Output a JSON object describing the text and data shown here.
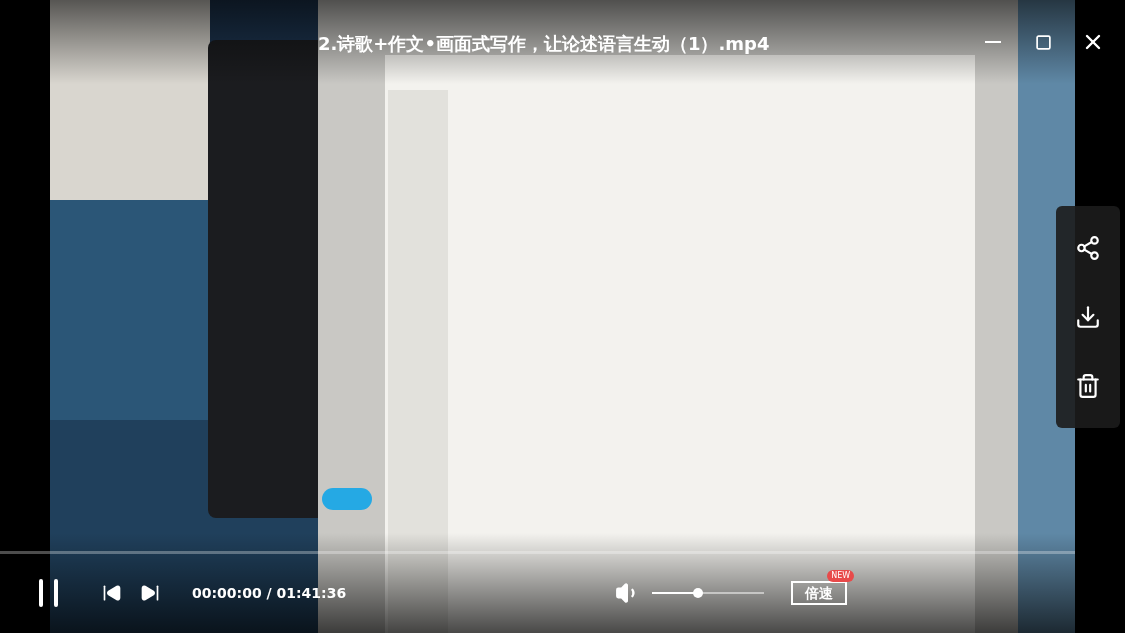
{
  "title": "2.诗歌+作文•画面式写作，让论述语言生动（1）.mp4",
  "side_panel": [
    {
      "kind": "share"
    },
    {
      "kind": "download"
    },
    {
      "kind": "delete"
    }
  ],
  "controls": {
    "playing": true,
    "time": "00:00:00 / 01:41:36",
    "volume": {
      "level": 0.41
    },
    "speed_button": {
      "label": "倍速",
      "badge": "NEW"
    }
  }
}
